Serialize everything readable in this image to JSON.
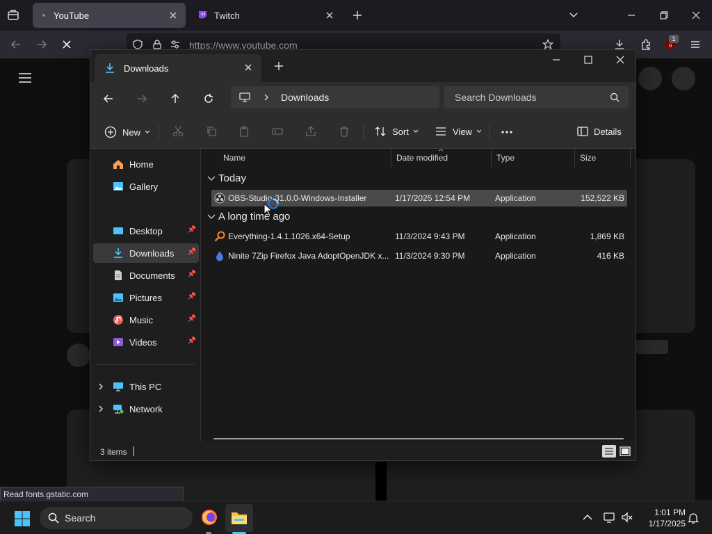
{
  "browser": {
    "tabs": [
      {
        "label": "YouTube",
        "active": true
      },
      {
        "label": "Twitch",
        "active": false
      }
    ],
    "url": "https://www.youtube.com",
    "extension_badge": "1",
    "status_text": "Read fonts.gstatic.com"
  },
  "explorer": {
    "tab_title": "Downloads",
    "breadcrumb": "Downloads",
    "search_placeholder": "Search Downloads",
    "toolbar": {
      "new_label": "New",
      "sort_label": "Sort",
      "view_label": "View",
      "details_label": "Details"
    },
    "nav": {
      "home": "Home",
      "gallery": "Gallery",
      "desktop": "Desktop",
      "downloads": "Downloads",
      "documents": "Documents",
      "pictures": "Pictures",
      "music": "Music",
      "videos": "Videos",
      "this_pc": "This PC",
      "network": "Network"
    },
    "columns": {
      "name": "Name",
      "date": "Date modified",
      "type": "Type",
      "size": "Size"
    },
    "groups": [
      {
        "label": "Today",
        "files": [
          {
            "name": "OBS-Studio-31.0.0-Windows-Installer",
            "date": "1/17/2025 12:54 PM",
            "type": "Application",
            "size": "152,522 KB",
            "selected": true
          }
        ]
      },
      {
        "label": "A long time ago",
        "files": [
          {
            "name": "Everything-1.4.1.1026.x64-Setup",
            "date": "11/3/2024 9:43 PM",
            "type": "Application",
            "size": "1,869 KB",
            "selected": false
          },
          {
            "name": "Ninite 7Zip Firefox Java AdoptOpenJDK x...",
            "date": "11/3/2024 9:30 PM",
            "type": "Application",
            "size": "416 KB",
            "selected": false
          }
        ]
      }
    ],
    "status": "3 items"
  },
  "taskbar": {
    "search_label": "Search",
    "time": "1:01 PM",
    "date": "1/17/2025"
  },
  "colors": {
    "accent": "#4cc2ff",
    "youtube_red": "#ff0000",
    "twitch_purple": "#9146ff",
    "folder": "#f2c14e"
  }
}
